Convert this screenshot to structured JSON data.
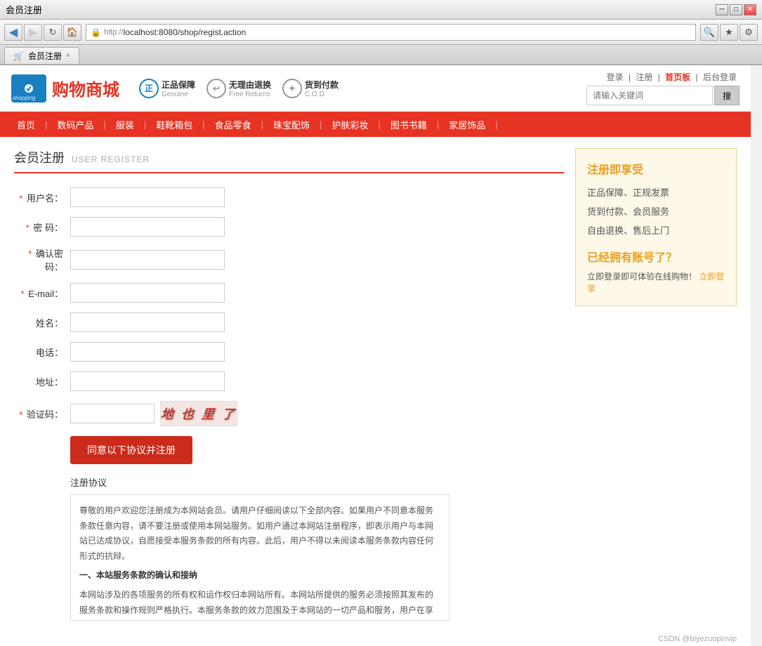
{
  "browser": {
    "title": "会员注册",
    "url": "http://localhost:8080/shop/regist.action",
    "tab_label": "会员注册",
    "tab_close": "×",
    "nav_back": "◀",
    "nav_forward": "▶",
    "search_placeholder": "搜索",
    "scroll_up": "▲",
    "scroll_down": "▼"
  },
  "header": {
    "logo_text": "购物商城",
    "logo_sub": "shopping",
    "badge1_title": "正品保障",
    "badge1_sub": "Genuine",
    "badge2_title": "无理由退换",
    "badge2_sub": "Free Returns",
    "badge3_title": "货到付款",
    "badge3_sub": "C.O.D",
    "links": {
      "login": "登录",
      "register": "注册",
      "dashboard": "首页板",
      "admin": "后台登录"
    },
    "search_placeholder": "请输入关键词",
    "search_btn": "搜"
  },
  "nav": {
    "items": [
      "首页",
      "数码产品",
      "服装",
      "鞋靴箱包",
      "食品零食",
      "珠宝配饰",
      "护肤彩妆",
      "图书书籍",
      "家居饰品"
    ]
  },
  "page": {
    "title": "会员注册",
    "title_sub": "USER REGISTER"
  },
  "form": {
    "username_label": "用户名：",
    "password_label": "密  码：",
    "confirm_label": "确认密码：",
    "email_label": "E-mail：",
    "name_label": "姓名：",
    "phone_label": "电话：",
    "address_label": "地址：",
    "captcha_label": "验证码：",
    "captcha_text": "地 也 里 了",
    "submit_btn": "同意以下协议并注册"
  },
  "agreement": {
    "title": "注册协议",
    "content_p1": "尊敬的用户欢迎您注册成为本网站会员。请用户仔细阅读以下全部内容。如果用户不同意本服务条款任意内容，请不要注册或使用本网站服务。如用户通过本网站注册程序，即表示用户与本网站已达成协议，自愿接受本服务条款的所有内容。此后，用户不得以未阅读本服务条款内容任何形式的抗辩。",
    "content_p2": "一、本站服务条款的确认和接纳",
    "content_p3": "本网站涉及的各项服务的所有权和运作权归本网站所有。本网站所提供的服务必须按照其发布的服务条款和操作规则严格执行。本服务条款的效力范围及于本网站的一切产品和服务，用户在享受本网站任何单项服务时，应当受本服务条款的约束。"
  },
  "sidebar": {
    "benefits_title": "注册即享受",
    "benefit1": "正品保障、正规发票",
    "benefit2": "货到付款、会员服务",
    "benefit3": "自由退换、售后上门",
    "account_title": "已经拥有账号了？",
    "account_prompt": "立即登录即可体验在线购物！",
    "login_link": "立即登录"
  },
  "watermark": "CSDN @biyezuopinvip"
}
